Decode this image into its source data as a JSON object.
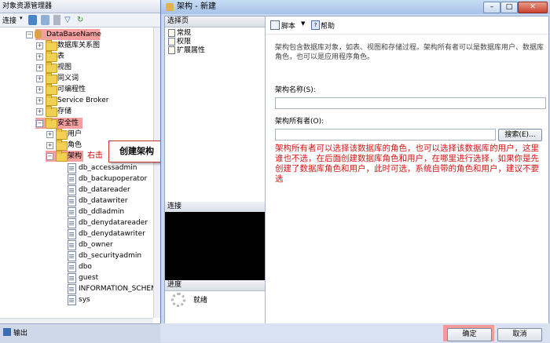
{
  "object_explorer": {
    "title": "对象资源管理器",
    "connect_label": "连接",
    "database": "DataBaseName",
    "nodes": [
      "数据库关系图",
      "表",
      "视图",
      "同义词",
      "可编程性",
      "Service Broker",
      "存储",
      "安全性",
      "用户",
      "角色",
      "架构"
    ],
    "schemas": [
      "db_accessadmin",
      "db_backupoperator",
      "db_datareader",
      "db_datawriter",
      "db_ddladmin",
      "db_denydatareader",
      "db_denydatawriter",
      "db_owner",
      "db_securityadmin",
      "dbo",
      "guest",
      "INFORMATION_SCHEMA",
      "sys"
    ],
    "output_label": "输出"
  },
  "annotation": {
    "right_click": "右击",
    "create_schema": "创建架构"
  },
  "dialog": {
    "title": "架构 - 新建",
    "select_page": "选择页",
    "pages": [
      "常规",
      "权限",
      "扩展属性"
    ],
    "connection": "连接",
    "progress": "进度",
    "progress_status": "就绪",
    "toolbar_script": "脚本",
    "toolbar_help": "帮助",
    "description": "架构包含数据库对象，如表、视图和存储过程。架构所有者可以是数据库用户、数据库角色，也可以是应用程序角色。",
    "schema_name_label": "架构名称(S):",
    "schema_name_value": "",
    "schema_owner_label": "架构所有者(O):",
    "schema_owner_value": "",
    "search_button": "搜索(E)...",
    "note": "架构所有者可以选择该数据库的角色，也可以选择该数据库的用户，这里谁也不选，在后面创建数据库角色和用户，在哪里进行选择，如果你是先创建了数据库角色和用户，此时可选，系统自带的角色和用户，建议不要选",
    "ok_button": "确定",
    "cancel_button": "取消"
  }
}
